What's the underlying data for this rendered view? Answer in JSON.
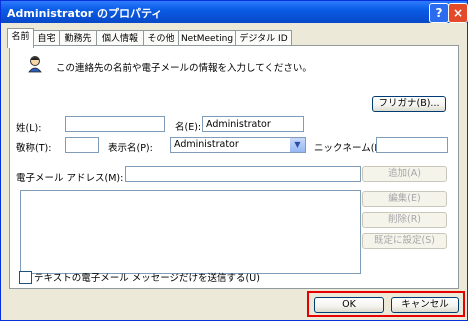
{
  "window": {
    "title": "Administrator のプロパティ",
    "help_label": "?",
    "close_label": "×"
  },
  "tabs": [
    {
      "label": "名前",
      "active": true
    },
    {
      "label": "自宅"
    },
    {
      "label": "勤務先"
    },
    {
      "label": "個人情報"
    },
    {
      "label": "その他"
    },
    {
      "label": "NetMeeting"
    },
    {
      "label": "デジタル ID"
    }
  ],
  "intro_text": "この連絡先の名前や電子メールの情報を入力してください。",
  "furigana_button": "フリガナ(B)...",
  "form": {
    "last_name_label": "姓(L):",
    "last_name_value": "",
    "first_name_label": "名(E):",
    "first_name_value": "Administrator",
    "title_label": "敬称(T):",
    "title_value": "",
    "display_label": "表示名(P):",
    "display_value": "Administrator",
    "nickname_label": "ニックネーム(N):",
    "nickname_value": "",
    "email_label": "電子メール アドレス(M):",
    "email_value": ""
  },
  "email_buttons": {
    "add": "追加(A)",
    "edit": "編集(E)",
    "delete": "削除(R)",
    "default": "既定に設定(S)"
  },
  "text_only_label": "テキストの電子メール メッセージだけを送信する(U)",
  "footer": {
    "ok": "OK",
    "cancel": "キャンセル"
  }
}
